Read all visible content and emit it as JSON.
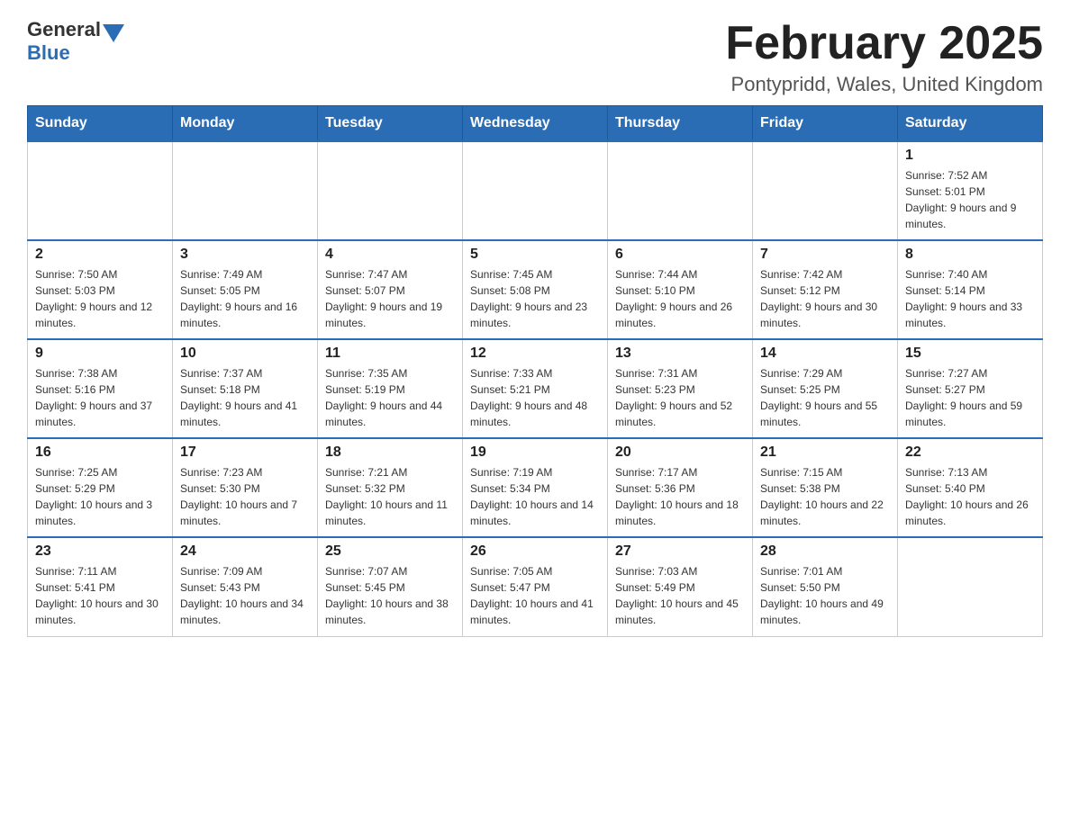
{
  "header": {
    "logo_general": "General",
    "logo_blue": "Blue",
    "title": "February 2025",
    "subtitle": "Pontypridd, Wales, United Kingdom"
  },
  "calendar": {
    "days_of_week": [
      "Sunday",
      "Monday",
      "Tuesday",
      "Wednesday",
      "Thursday",
      "Friday",
      "Saturday"
    ],
    "weeks": [
      [
        {
          "day": "",
          "info": ""
        },
        {
          "day": "",
          "info": ""
        },
        {
          "day": "",
          "info": ""
        },
        {
          "day": "",
          "info": ""
        },
        {
          "day": "",
          "info": ""
        },
        {
          "day": "",
          "info": ""
        },
        {
          "day": "1",
          "info": "Sunrise: 7:52 AM\nSunset: 5:01 PM\nDaylight: 9 hours and 9 minutes."
        }
      ],
      [
        {
          "day": "2",
          "info": "Sunrise: 7:50 AM\nSunset: 5:03 PM\nDaylight: 9 hours and 12 minutes."
        },
        {
          "day": "3",
          "info": "Sunrise: 7:49 AM\nSunset: 5:05 PM\nDaylight: 9 hours and 16 minutes."
        },
        {
          "day": "4",
          "info": "Sunrise: 7:47 AM\nSunset: 5:07 PM\nDaylight: 9 hours and 19 minutes."
        },
        {
          "day": "5",
          "info": "Sunrise: 7:45 AM\nSunset: 5:08 PM\nDaylight: 9 hours and 23 minutes."
        },
        {
          "day": "6",
          "info": "Sunrise: 7:44 AM\nSunset: 5:10 PM\nDaylight: 9 hours and 26 minutes."
        },
        {
          "day": "7",
          "info": "Sunrise: 7:42 AM\nSunset: 5:12 PM\nDaylight: 9 hours and 30 minutes."
        },
        {
          "day": "8",
          "info": "Sunrise: 7:40 AM\nSunset: 5:14 PM\nDaylight: 9 hours and 33 minutes."
        }
      ],
      [
        {
          "day": "9",
          "info": "Sunrise: 7:38 AM\nSunset: 5:16 PM\nDaylight: 9 hours and 37 minutes."
        },
        {
          "day": "10",
          "info": "Sunrise: 7:37 AM\nSunset: 5:18 PM\nDaylight: 9 hours and 41 minutes."
        },
        {
          "day": "11",
          "info": "Sunrise: 7:35 AM\nSunset: 5:19 PM\nDaylight: 9 hours and 44 minutes."
        },
        {
          "day": "12",
          "info": "Sunrise: 7:33 AM\nSunset: 5:21 PM\nDaylight: 9 hours and 48 minutes."
        },
        {
          "day": "13",
          "info": "Sunrise: 7:31 AM\nSunset: 5:23 PM\nDaylight: 9 hours and 52 minutes."
        },
        {
          "day": "14",
          "info": "Sunrise: 7:29 AM\nSunset: 5:25 PM\nDaylight: 9 hours and 55 minutes."
        },
        {
          "day": "15",
          "info": "Sunrise: 7:27 AM\nSunset: 5:27 PM\nDaylight: 9 hours and 59 minutes."
        }
      ],
      [
        {
          "day": "16",
          "info": "Sunrise: 7:25 AM\nSunset: 5:29 PM\nDaylight: 10 hours and 3 minutes."
        },
        {
          "day": "17",
          "info": "Sunrise: 7:23 AM\nSunset: 5:30 PM\nDaylight: 10 hours and 7 minutes."
        },
        {
          "day": "18",
          "info": "Sunrise: 7:21 AM\nSunset: 5:32 PM\nDaylight: 10 hours and 11 minutes."
        },
        {
          "day": "19",
          "info": "Sunrise: 7:19 AM\nSunset: 5:34 PM\nDaylight: 10 hours and 14 minutes."
        },
        {
          "day": "20",
          "info": "Sunrise: 7:17 AM\nSunset: 5:36 PM\nDaylight: 10 hours and 18 minutes."
        },
        {
          "day": "21",
          "info": "Sunrise: 7:15 AM\nSunset: 5:38 PM\nDaylight: 10 hours and 22 minutes."
        },
        {
          "day": "22",
          "info": "Sunrise: 7:13 AM\nSunset: 5:40 PM\nDaylight: 10 hours and 26 minutes."
        }
      ],
      [
        {
          "day": "23",
          "info": "Sunrise: 7:11 AM\nSunset: 5:41 PM\nDaylight: 10 hours and 30 minutes."
        },
        {
          "day": "24",
          "info": "Sunrise: 7:09 AM\nSunset: 5:43 PM\nDaylight: 10 hours and 34 minutes."
        },
        {
          "day": "25",
          "info": "Sunrise: 7:07 AM\nSunset: 5:45 PM\nDaylight: 10 hours and 38 minutes."
        },
        {
          "day": "26",
          "info": "Sunrise: 7:05 AM\nSunset: 5:47 PM\nDaylight: 10 hours and 41 minutes."
        },
        {
          "day": "27",
          "info": "Sunrise: 7:03 AM\nSunset: 5:49 PM\nDaylight: 10 hours and 45 minutes."
        },
        {
          "day": "28",
          "info": "Sunrise: 7:01 AM\nSunset: 5:50 PM\nDaylight: 10 hours and 49 minutes."
        },
        {
          "day": "",
          "info": ""
        }
      ]
    ]
  }
}
